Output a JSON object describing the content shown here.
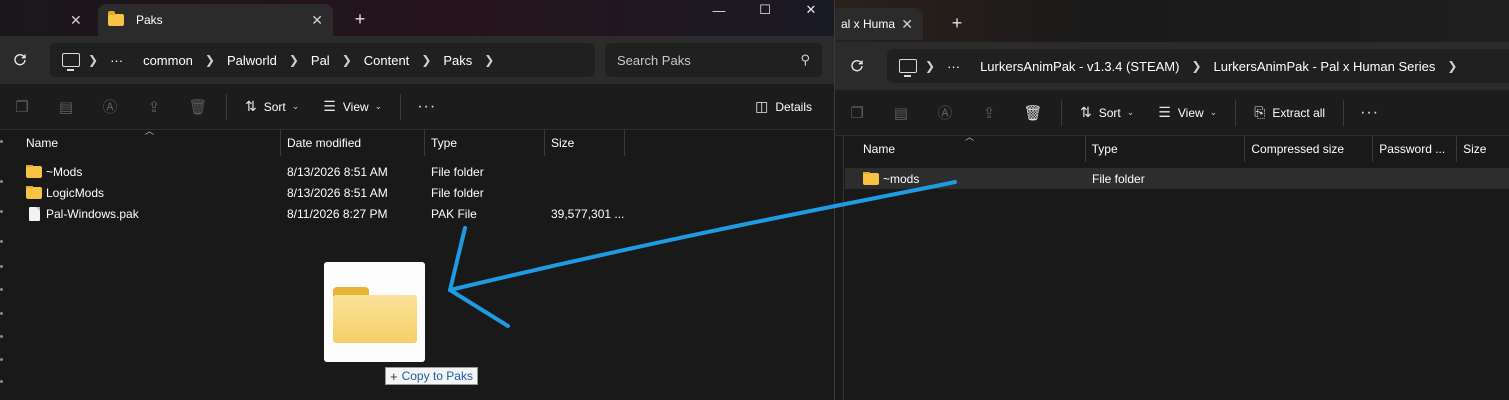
{
  "left_window": {
    "tab_label": "Paks",
    "tab_close": "✕",
    "new_tab": "+",
    "controls": {
      "minimize": "—",
      "maximize": "☐",
      "close": "✕"
    },
    "breadcrumb": [
      "common",
      "Palworld",
      "Pal",
      "Content",
      "Paks"
    ],
    "overflow": "···",
    "search_placeholder": "Search Paks",
    "toolbar": {
      "sort": "Sort",
      "view": "View",
      "details": "Details",
      "more": "···"
    },
    "columns": {
      "name": "Name",
      "date": "Date modified",
      "type": "Type",
      "size": "Size"
    },
    "files": [
      {
        "name": "~Mods",
        "date": "8/13/2026 8:51 AM",
        "type": "File folder",
        "size": "",
        "icon": "folder-icon"
      },
      {
        "name": "LogicMods",
        "date": "8/13/2026 8:51 AM",
        "type": "File folder",
        "size": "",
        "icon": "folder-icon"
      },
      {
        "name": "Pal-Windows.pak",
        "date": "8/11/2026 8:27 PM",
        "type": "PAK File",
        "size": "39,577,301 ...",
        "icon": "file-icon"
      }
    ]
  },
  "right_window": {
    "tab_label": "al x Huma",
    "tab_close": "✕",
    "new_tab": "+",
    "breadcrumb": [
      "LurkersAnimPak - v1.3.4 (STEAM)",
      "LurkersAnimPak - Pal x Human Series"
    ],
    "overflow": "···",
    "toolbar": {
      "sort": "Sort",
      "view": "View",
      "extract_all": "Extract all",
      "more": "···"
    },
    "columns": {
      "name": "Name",
      "type": "Type",
      "compressed": "Compressed size",
      "password": "Password ...",
      "size": "Size"
    },
    "files": [
      {
        "name": "~mods",
        "type": "File folder",
        "icon": "folder-icon"
      }
    ]
  },
  "drag": {
    "tooltip_plus": "+",
    "tooltip_text": "Copy to Paks"
  },
  "colors": {
    "arrow": "#1e9be3",
    "folder": "#f6c343",
    "background": "#191919",
    "tooltip_text": "#1d5ea8"
  }
}
